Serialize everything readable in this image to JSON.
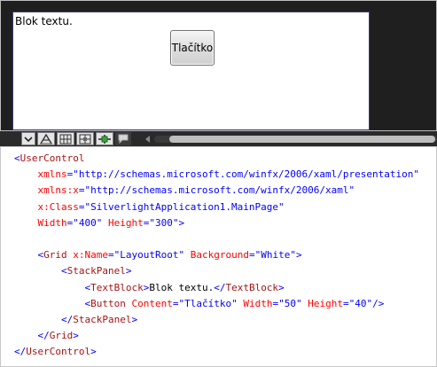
{
  "preview": {
    "textblock_text": "Blok textu.",
    "button_label": "Tlačítko"
  },
  "toolbar": {
    "items": [
      {
        "icon": "zoom-dropdown-icon"
      },
      {
        "icon": "snap-to-snaplines-icon"
      },
      {
        "icon": "grid-icon"
      },
      {
        "icon": "show-snap-grid-icon"
      },
      {
        "icon": "snap-to-gridlines-icon"
      },
      {
        "icon": "annotation-icon"
      }
    ]
  },
  "code": {
    "l1_open": "<",
    "l1_tag": "UserControl",
    "l2_attr": "xmlns",
    "l2_eq": "=",
    "l2_val": "\"http://schemas.microsoft.com/winfx/2006/xaml/presentation\"",
    "l3_attr": "xmlns:x",
    "l3_eq": "=",
    "l3_val": "\"http://schemas.microsoft.com/winfx/2006/xaml\"",
    "l4_attr": "x:Class",
    "l4_eq": "=",
    "l4_val": "\"SilverlightApplication1.MainPage\"",
    "l5_attr1": "Width",
    "l5_eq1": "=",
    "l5_val1": "\"400\"",
    "l5_attr2": "Height",
    "l5_eq2": "=",
    "l5_val2": "\"300\"",
    "l5_close": ">",
    "l7_open": "<",
    "l7_tag": "Grid",
    "l7_attr1": "x:Name",
    "l7_eq1": "=",
    "l7_val1": "\"LayoutRoot\"",
    "l7_attr2": "Background",
    "l7_eq2": "=",
    "l7_val2": "\"White\"",
    "l7_close": ">",
    "l8_open": "<",
    "l8_tag": "StackPanel",
    "l8_close": ">",
    "l9_open": "<",
    "l9_tag": "TextBlock",
    "l9_mid": ">",
    "l9_text": "Blok textu.",
    "l9_open2": "</",
    "l9_tag2": "TextBlock",
    "l9_close": ">",
    "l10_open": "<",
    "l10_tag": "Button",
    "l10_attr1": "Content",
    "l10_eq1": "=",
    "l10_val1": "\"Tlačítko\"",
    "l10_attr2": "Width",
    "l10_eq2": "=",
    "l10_val2": "\"50\"",
    "l10_attr3": "Height",
    "l10_eq3": "=",
    "l10_val3": "\"40\"",
    "l10_close": "/>",
    "l11_open": "</",
    "l11_tag": "StackPanel",
    "l11_close": ">",
    "l12_open": "</",
    "l12_tag": "Grid",
    "l12_close": ">",
    "l13_open": "</",
    "l13_tag": "UserControl",
    "l13_close": ">"
  }
}
